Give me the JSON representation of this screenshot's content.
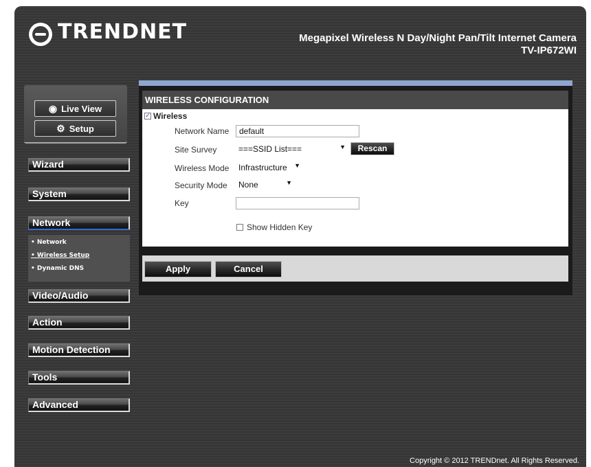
{
  "header": {
    "brand": "TRENDNET",
    "product_title": "Megapixel Wireless N Day/Night Pan/Tilt Internet Camera",
    "model": "TV-IP672WI",
    "logo_icon": "trendnet-logo-icon"
  },
  "quick": {
    "live_view": "Live View",
    "setup": "Setup",
    "live_view_icon": "eye-icon",
    "setup_icon": "gear-icon"
  },
  "nav": {
    "items": [
      "Wizard",
      "System",
      "Network",
      "Video/Audio",
      "Action",
      "Motion Detection",
      "Tools",
      "Advanced"
    ],
    "active": "Network",
    "network_sub": [
      "• Network",
      "• Wireless Setup",
      "• Dynamic DNS"
    ],
    "current_sub": "• Wireless Setup"
  },
  "form": {
    "section_title": "WIRELESS CONFIGURATION",
    "wireless_label": "Wireless",
    "wireless_checked": true,
    "network_name_label": "Network Name",
    "network_name_value": "default",
    "site_survey_label": "Site Survey",
    "site_survey_value": "===SSID List===",
    "rescan": "Rescan",
    "wireless_mode_label": "Wireless Mode",
    "wireless_mode_value": "Infrastructure",
    "security_mode_label": "Security Mode",
    "security_mode_value": "None",
    "key_label": "Key",
    "key_value": "",
    "show_hidden_key": "Show Hidden Key",
    "show_hidden_key_checked": false,
    "apply": "Apply",
    "cancel": "Cancel"
  },
  "footer": {
    "copyright": "Copyright © 2012 TRENDnet. All Rights Reserved."
  },
  "colors": {
    "accent_bar": "#8fa7cf",
    "active_underline": "#2e6bd8"
  }
}
